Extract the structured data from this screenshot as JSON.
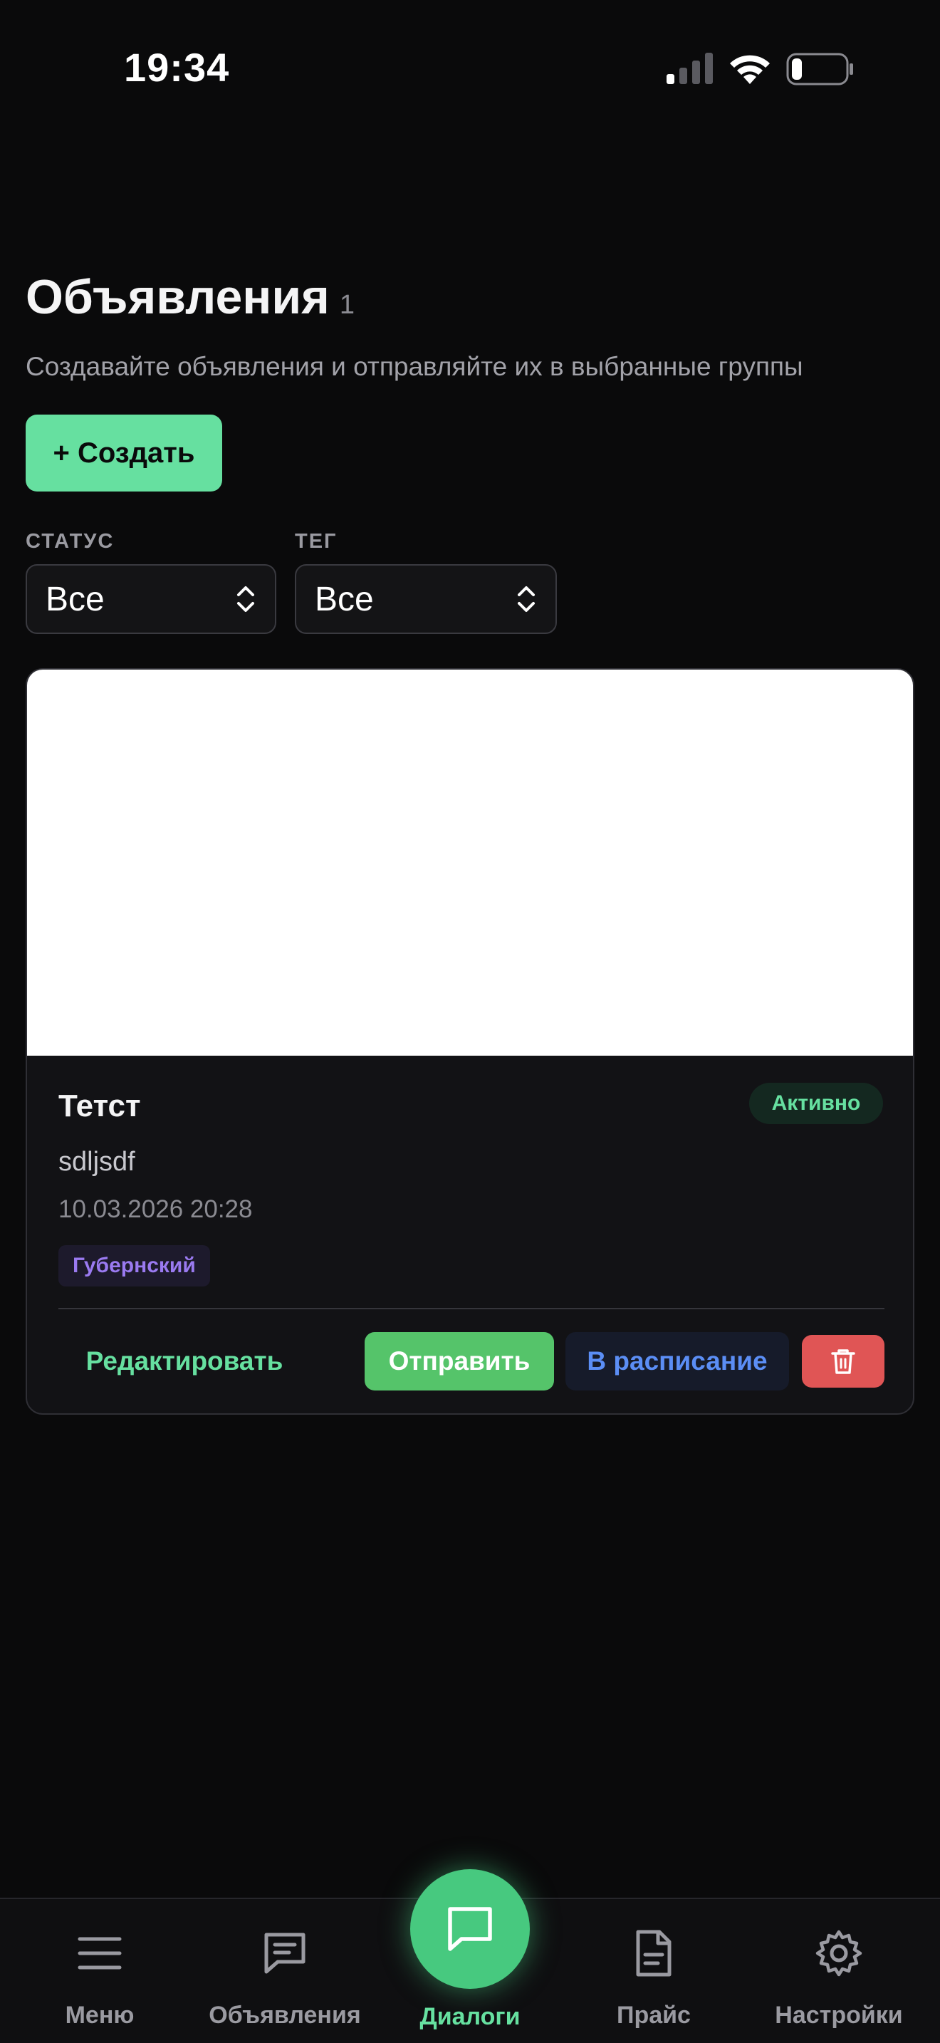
{
  "status_bar": {
    "time": "19:34"
  },
  "header": {
    "title": "Объявления",
    "count": "1",
    "subtitle": "Создавайте объявления и отправляйте их в выбранные группы",
    "create_label": "+ Создать"
  },
  "filters": {
    "status": {
      "label": "СТАТУС",
      "value": "Все"
    },
    "tag": {
      "label": "ТЕГ",
      "value": "Все"
    }
  },
  "card": {
    "title": "Тетст",
    "status": "Активно",
    "description": "sdljsdf",
    "date": "10.03.2026 20:28",
    "tag": "Губернский",
    "actions": {
      "edit": "Редактировать",
      "send": "Отправить",
      "schedule": "В расписание"
    }
  },
  "nav": {
    "items": [
      {
        "label": "Меню",
        "icon": "menu-icon"
      },
      {
        "label": "Объявления",
        "icon": "message-square-text-icon"
      },
      {
        "label": "Диалоги",
        "icon": "message-square-icon"
      },
      {
        "label": "Прайс",
        "icon": "file-text-icon"
      },
      {
        "label": "Настройки",
        "icon": "gear-icon"
      }
    ]
  },
  "colors": {
    "accent": "#66e0a0",
    "send": "#55c46a",
    "schedule_text": "#5b8ef5",
    "delete": "#e05555",
    "tag_text": "#9a7af0",
    "background": "#0a0a0b"
  }
}
